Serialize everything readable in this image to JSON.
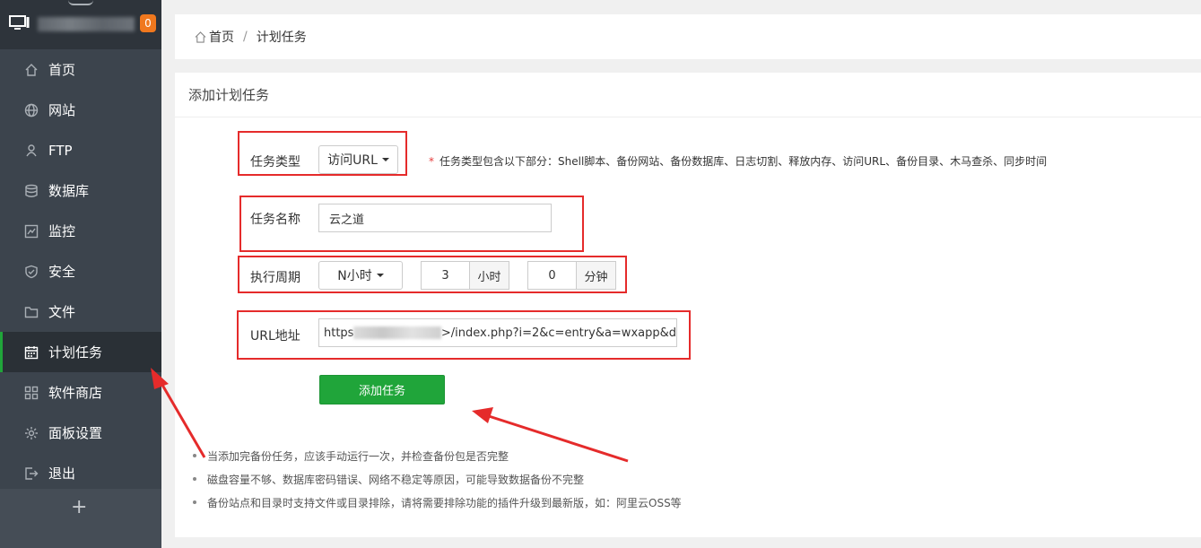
{
  "sidebar": {
    "badge": "0",
    "items": [
      {
        "label": "首页",
        "icon": "home-icon"
      },
      {
        "label": "网站",
        "icon": "globe-icon"
      },
      {
        "label": "FTP",
        "icon": "ftp-icon"
      },
      {
        "label": "数据库",
        "icon": "database-icon"
      },
      {
        "label": "监控",
        "icon": "monitor-chart-icon"
      },
      {
        "label": "安全",
        "icon": "shield-icon"
      },
      {
        "label": "文件",
        "icon": "folder-icon"
      },
      {
        "label": "计划任务",
        "icon": "calendar-icon",
        "active": true
      },
      {
        "label": "软件商店",
        "icon": "grid-icon"
      },
      {
        "label": "面板设置",
        "icon": "gear-icon"
      },
      {
        "label": "退出",
        "icon": "logout-icon"
      }
    ],
    "add_label": "+"
  },
  "breadcrumb": {
    "home": "首页",
    "separator": "/",
    "current": "计划任务"
  },
  "panel": {
    "title": "添加计划任务",
    "task_type": {
      "label": "任务类型",
      "value": "访问URL"
    },
    "task_type_hint": "任务类型包含以下部分：Shell脚本、备份网站、备份数据库、日志切割、释放内存、访问URL、备份目录、木马查杀、同步时间",
    "hint_star": "*",
    "task_name": {
      "label": "任务名称",
      "value": "云之道"
    },
    "period": {
      "label": "执行周期",
      "select_value": "N小时",
      "hours_value": "3",
      "hours_unit": "小时",
      "minutes_value": "0",
      "minutes_unit": "分钟"
    },
    "url": {
      "label": "URL地址",
      "prefix": "https",
      "suffix": ">/index.php?i=2&c=entry&a=wxapp&d"
    },
    "submit_label": "添加任务",
    "notes": [
      "当添加完备份任务，应该手动运行一次，并检查备份包是否完整",
      "磁盘容量不够、数据库密码错误、网络不稳定等原因，可能导致数据备份不完整",
      "备份站点和目录时支持文件或目录排除，请将需要排除功能的插件升级到最新版，如：阿里云OSS等"
    ]
  },
  "colors": {
    "sidebar_bg": "#3c444d",
    "accent_green": "#20a53a",
    "annotation_red": "#e52b2b",
    "badge_orange": "#f0781e"
  }
}
